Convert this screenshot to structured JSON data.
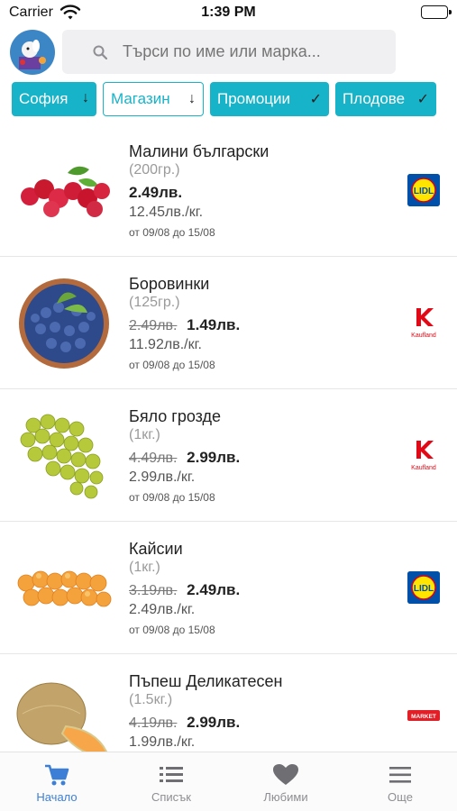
{
  "status_bar": {
    "carrier": "Carrier",
    "time": "1:39 PM"
  },
  "search": {
    "placeholder": "Търси по име или марка..."
  },
  "filters": [
    {
      "label": "София",
      "symbol": "↓",
      "style": "filled"
    },
    {
      "label": "Магазин",
      "symbol": "↓",
      "style": "outline"
    },
    {
      "label": "Промоции",
      "symbol": "✓",
      "style": "filled"
    },
    {
      "label": "Плодове",
      "symbol": "✓",
      "style": "filled"
    }
  ],
  "products": [
    {
      "name": "Малини български",
      "quantity": "(200гр.)",
      "old_price": "",
      "price": "2.49лв.",
      "unit_price": "12.45лв./кг.",
      "dates": "от 09/08 до 15/08",
      "store": "lidl",
      "thumb": "raspberries"
    },
    {
      "name": "Боровинки",
      "quantity": "(125гр.)",
      "old_price": "2.49лв.",
      "price": "1.49лв.",
      "unit_price": "11.92лв./кг.",
      "dates": "от 09/08 до 15/08",
      "store": "kaufland",
      "thumb": "blueberries"
    },
    {
      "name": "Бяло грозде",
      "quantity": "(1кг.)",
      "old_price": "4.49лв.",
      "price": "2.99лв.",
      "unit_price": "2.99лв./кг.",
      "dates": "от 09/08 до 15/08",
      "store": "kaufland",
      "thumb": "grapes"
    },
    {
      "name": "Кайсии",
      "quantity": "(1кг.)",
      "old_price": "3.19лв.",
      "price": "2.49лв.",
      "unit_price": "2.49лв./кг.",
      "dates": "от 09/08 до 15/08",
      "store": "lidl",
      "thumb": "apricots"
    },
    {
      "name": "Пъпеш Деликатесен",
      "quantity": "(1.5кг.)",
      "old_price": "4.19лв.",
      "price": "2.99лв.",
      "unit_price": "1.99лв./кг.",
      "dates": "",
      "store": "market",
      "thumb": "melon"
    }
  ],
  "store_logos": {
    "lidl": "LIDL",
    "kaufland": "Kaufland",
    "market": "MARKET"
  },
  "tabbar": [
    {
      "label": "Начало",
      "icon": "cart-icon",
      "active": true
    },
    {
      "label": "Списък",
      "icon": "list-icon",
      "active": false
    },
    {
      "label": "Любими",
      "icon": "heart-icon",
      "active": false
    },
    {
      "label": "Още",
      "icon": "menu-icon",
      "active": false
    }
  ],
  "colors": {
    "accent": "#17b3c9",
    "active_tab": "#3d7fd6",
    "lidl_blue": "#0050aa",
    "lidl_yellow": "#ffe500",
    "kaufland_red": "#e10915"
  }
}
